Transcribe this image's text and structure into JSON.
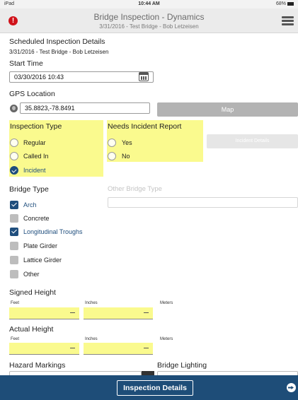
{
  "status_bar": {
    "device": "iPad",
    "time": "10:44 AM",
    "battery": "68%"
  },
  "header": {
    "title": "Bridge Inspection - Dynamics",
    "subtitle": "3/31/2016 - Test Bridge - Bob Letzeisen",
    "alert_glyph": "!"
  },
  "scheduled": {
    "heading": "Scheduled Inspection Details",
    "value": "3/31/2016 - Test Bridge - Bob Letzeisen"
  },
  "start_time": {
    "label": "Start Time",
    "value": "03/30/2016 10:43"
  },
  "gps": {
    "label": "GPS Location",
    "value": "35.8823,-78.8491",
    "map_button": "Map"
  },
  "inspection_type": {
    "label": "Inspection Type",
    "options": [
      {
        "label": "Regular",
        "selected": false
      },
      {
        "label": "Called In",
        "selected": false
      },
      {
        "label": "Incident",
        "selected": true
      }
    ]
  },
  "incident_report": {
    "label": "Needs Incident Report",
    "options": [
      {
        "label": "Yes",
        "selected": false
      },
      {
        "label": "No",
        "selected": false
      }
    ],
    "details_button": "Incident Details"
  },
  "bridge_type": {
    "label": "Bridge Type",
    "other_label": "Other Bridge Type",
    "options": [
      {
        "label": "Arch",
        "checked": true
      },
      {
        "label": "Concrete",
        "checked": false
      },
      {
        "label": "Longitudinal Troughs",
        "checked": true
      },
      {
        "label": "Plate Girder",
        "checked": false
      },
      {
        "label": "Lattice Girder",
        "checked": false
      },
      {
        "label": "Other",
        "checked": false
      }
    ]
  },
  "signed_height": {
    "label": "Signed Height",
    "feet": "Feet",
    "inches": "Inches",
    "meters": "Meters"
  },
  "actual_height": {
    "label": "Actual Height",
    "feet": "Feet",
    "inches": "Inches",
    "meters": "Meters"
  },
  "hazard_markings": {
    "label": "Hazard Markings"
  },
  "bridge_lighting": {
    "label": "Bridge Lighting"
  },
  "footer": {
    "button": "Inspection Details"
  },
  "colors": {
    "accent": "#1e4d78",
    "highlight": "#fafa8e",
    "alert": "#d0121a"
  }
}
